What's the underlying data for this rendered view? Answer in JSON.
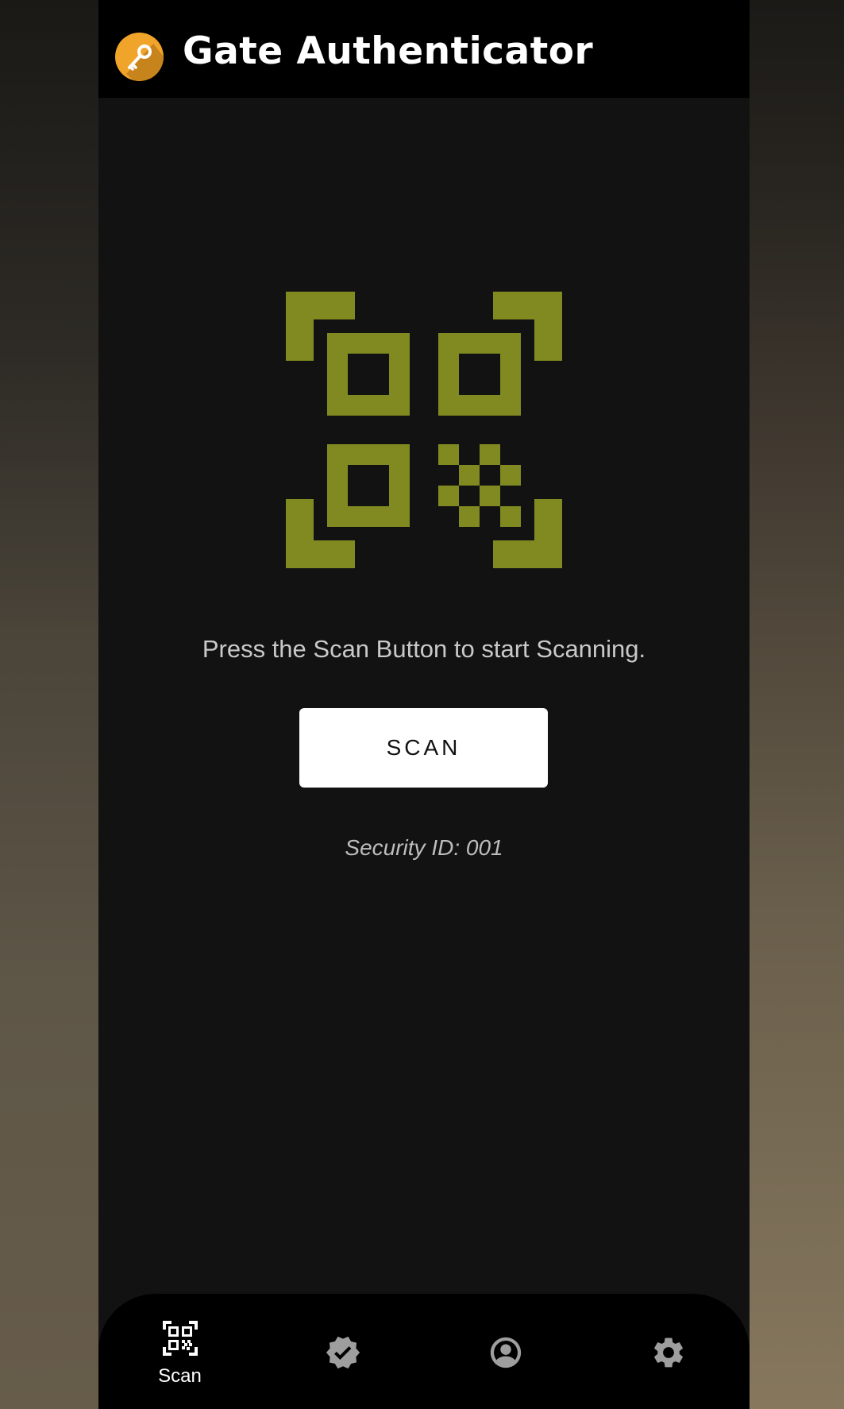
{
  "app": {
    "title": "Gate Authenticator",
    "logo_icon": "key-icon"
  },
  "main": {
    "illustration_icon": "qr-code-scan-icon",
    "instruction": "Press the Scan Button to start Scanning.",
    "scan_button_label": "SCAN",
    "security_id": "Security ID: 001"
  },
  "bottom_nav": {
    "items": [
      {
        "label": "Scan",
        "icon": "qr-scan-icon",
        "active": true
      },
      {
        "label": "",
        "icon": "verified-check-icon",
        "active": false
      },
      {
        "label": "",
        "icon": "account-circle-icon",
        "active": false
      },
      {
        "label": "",
        "icon": "gear-icon",
        "active": false
      }
    ]
  },
  "colors": {
    "accent_olive": "#818a20",
    "logo_orange": "#f0a52a",
    "background": "#121212",
    "bar": "#000000",
    "inactive_icon": "#9e9e9e"
  }
}
